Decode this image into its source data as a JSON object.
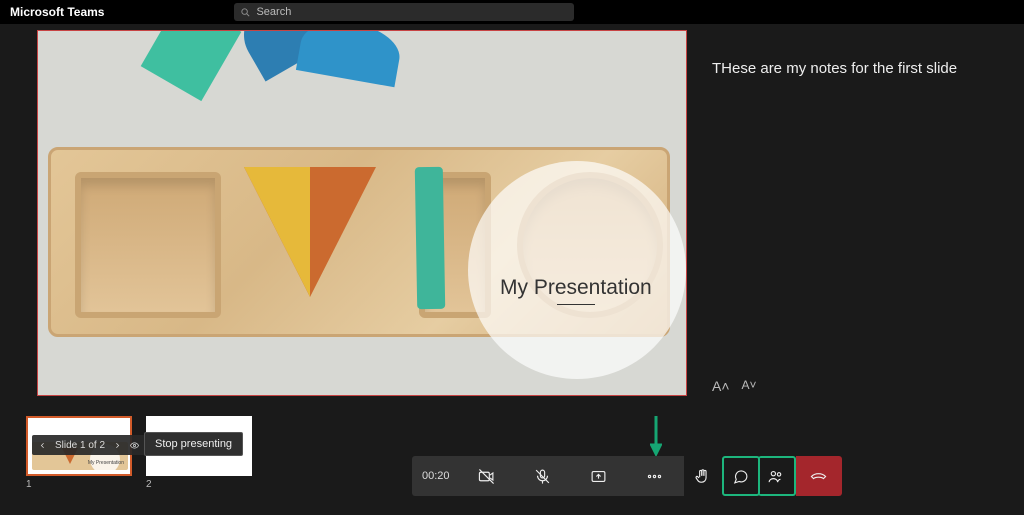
{
  "titlebar": {
    "app_name": "Microsoft Teams",
    "search_placeholder": "Search"
  },
  "slide": {
    "title": "My Presentation"
  },
  "notes": {
    "text": "THese are my notes for the first slide",
    "font_increase": "A˄",
    "font_decrease": "A˅"
  },
  "slide_nav": {
    "label": "Slide 1 of 2"
  },
  "controls": {
    "stop_presenting": "Stop presenting"
  },
  "thumbs": {
    "items": [
      {
        "index": "1",
        "title": "My Presentation"
      },
      {
        "index": "2",
        "title": ""
      }
    ]
  },
  "call": {
    "duration": "00:20"
  }
}
